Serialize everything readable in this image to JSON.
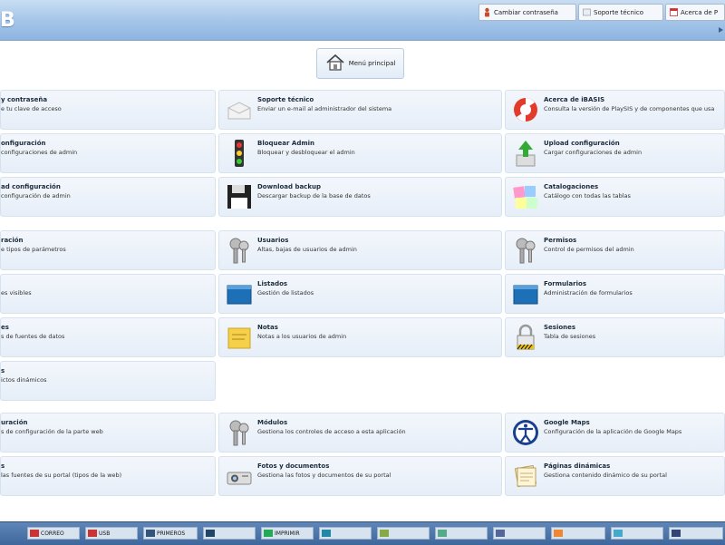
{
  "header": {
    "logo": "B",
    "buttons": [
      {
        "label": "Cambiar contraseña",
        "icon": "person-icon"
      },
      {
        "label": "Soporte técnico",
        "icon": "support-icon"
      },
      {
        "label": "Acerca de P",
        "icon": "calendar-icon"
      }
    ]
  },
  "main_menu": {
    "label": "Menú principal",
    "icon": "home-icon"
  },
  "sections": [
    {
      "rows": [
        [
          {
            "title": "y contraseña",
            "desc": "e tu clave de acceso",
            "icon": ""
          },
          {
            "title": "Soporte técnico",
            "desc": "Enviar un e-mail al administrador del sistema",
            "icon": "envelope-icon"
          },
          {
            "title": "Acerca de iBASIS",
            "desc": "Consulta la versión de PlaySIS y de componentes que usa",
            "icon": "lifebuoy-icon"
          }
        ],
        [
          {
            "title": "onfiguración",
            "desc": "configuraciones de admin",
            "icon": ""
          },
          {
            "title": "Bloquear Admin",
            "desc": "Bloquear y desbloquear el admin",
            "icon": "traffic-light-icon"
          },
          {
            "title": "Upload configuración",
            "desc": "Cargar configuraciones de admin",
            "icon": "upload-arrow-icon"
          }
        ],
        [
          {
            "title": "ad configuración",
            "desc": "configuración de admin",
            "icon": ""
          },
          {
            "title": "Download backup",
            "desc": "Descargar backup de la base de datos",
            "icon": "floppy-disk-icon"
          },
          {
            "title": "Catalogaciones",
            "desc": "Catálogo con todas las tablas",
            "icon": "sticky-notes-icon"
          }
        ]
      ]
    },
    {
      "rows": [
        [
          {
            "title": "ración",
            "desc": "e tipos de parámetros",
            "icon": ""
          },
          {
            "title": "Usuarios",
            "desc": "Altas, bajas de usuarios de admin",
            "icon": "keys-icon"
          },
          {
            "title": "Permisos",
            "desc": "Control de permisos del admin",
            "icon": "keys-icon"
          }
        ],
        [
          {
            "title": "",
            "desc": "es visibles",
            "icon": ""
          },
          {
            "title": "Listados",
            "desc": "Gestión de listados",
            "icon": "window-icon"
          },
          {
            "title": "Formularios",
            "desc": "Administración de formularios",
            "icon": "window-icon"
          }
        ],
        [
          {
            "title": "es",
            "desc": "s de fuentes de datos",
            "icon": ""
          },
          {
            "title": "Notas",
            "desc": "Notas a los usuarios de admin",
            "icon": "sticky-note-icon"
          },
          {
            "title": "Sesiones",
            "desc": "Tabla de sesiones",
            "icon": "padlock-icon"
          }
        ],
        [
          {
            "title": "s",
            "desc": "ictos dinámicos",
            "icon": ""
          }
        ]
      ]
    },
    {
      "rows": [
        [
          {
            "title": "uración",
            "desc": "s de configuración de la parte web",
            "icon": ""
          },
          {
            "title": "Módulos",
            "desc": "Gestiona los controles de acceso a esta aplicación",
            "icon": "keys-icon"
          },
          {
            "title": "Google Maps",
            "desc": "Configuración de la aplicación de Google Maps",
            "icon": "accessibility-icon"
          }
        ],
        [
          {
            "title": "s",
            "desc": "las fuentes de su portal (tipos de la web)",
            "icon": ""
          },
          {
            "title": "Fotos y documentos",
            "desc": "Gestiona las fotos y documentos de su portal",
            "icon": "projector-icon"
          },
          {
            "title": "Páginas dinámicas",
            "desc": "Gestiona contenido dinámico de su portal",
            "icon": "paper-stack-icon"
          }
        ]
      ]
    }
  ],
  "taskbar": {
    "items": [
      "CORREO",
      "USB",
      "PRIMEROS",
      "",
      "IMPRIMIR",
      "",
      "",
      "",
      "",
      "",
      "",
      ""
    ]
  },
  "colors": {
    "header": "#a9c8ea",
    "tile": "#e9f0f9",
    "taskbar": "#4a72a6"
  }
}
